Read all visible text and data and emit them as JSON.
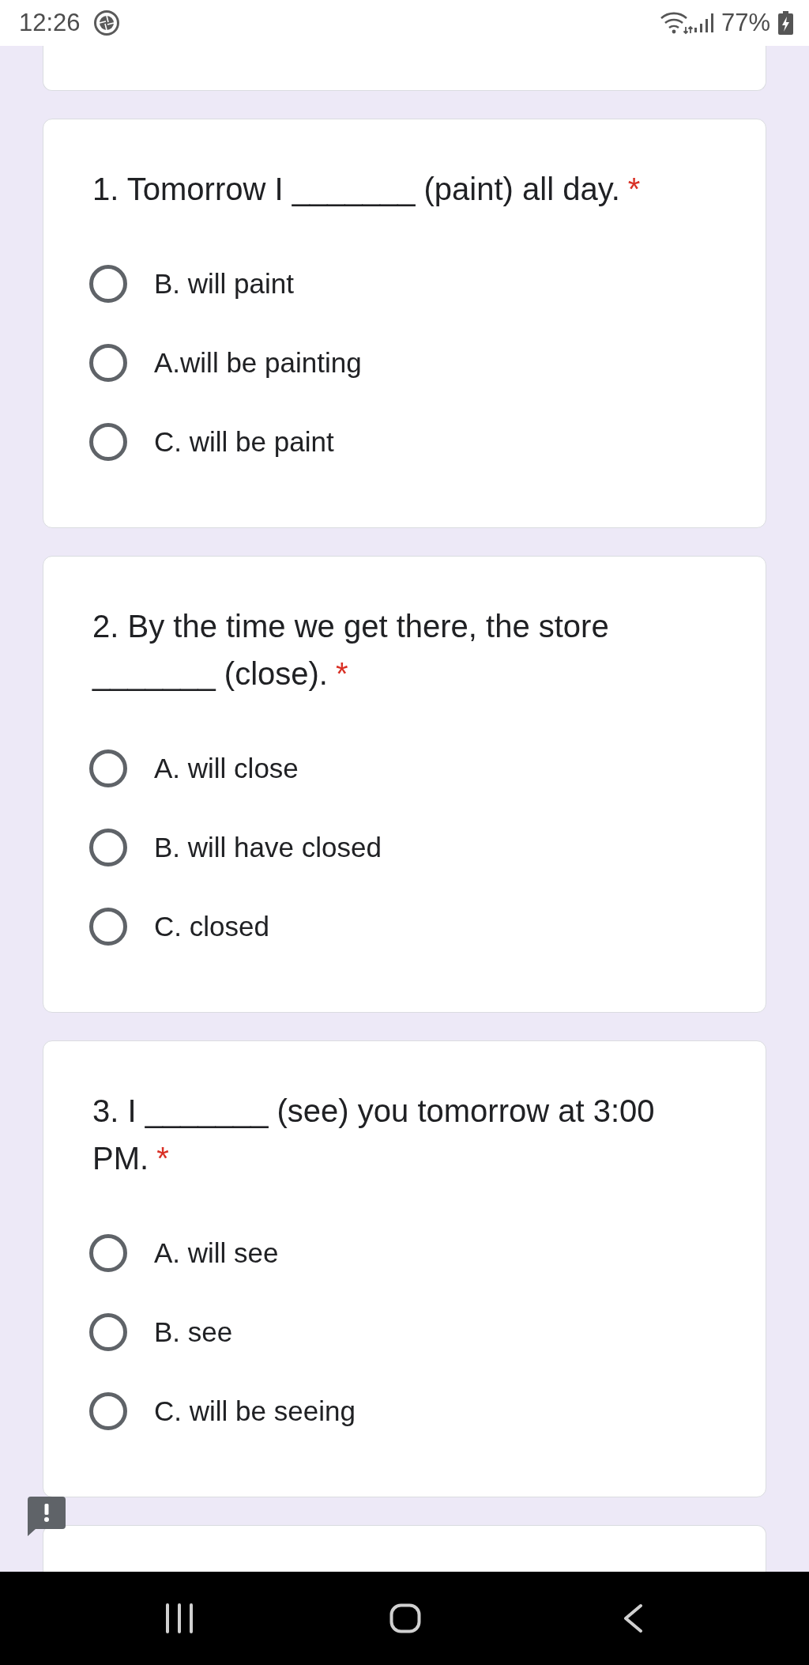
{
  "status_bar": {
    "time": "12:26",
    "battery_text": "77%"
  },
  "questions": [
    {
      "text": "1. Tomorrow I _______ (paint) all day.",
      "required_mark": "*",
      "options": [
        {
          "label": "B. will paint",
          "selected": false
        },
        {
          "label": "A.will be painting",
          "selected": false
        },
        {
          "label": "C. will be paint",
          "selected": false
        }
      ]
    },
    {
      "text": "2. By the time we get there, the store _______ (close).",
      "required_mark": "*",
      "options": [
        {
          "label": "A. will close",
          "selected": false
        },
        {
          "label": "B. will have closed",
          "selected": false
        },
        {
          "label": "C. closed",
          "selected": false
        }
      ]
    },
    {
      "text": "3. I _______ (see) you tomorrow at 3:00 PM.",
      "required_mark": "*",
      "options": [
        {
          "label": "A. will see",
          "selected": false
        },
        {
          "label": "B. see",
          "selected": false
        },
        {
          "label": "C. will be seeing",
          "selected": false
        }
      ]
    }
  ]
}
